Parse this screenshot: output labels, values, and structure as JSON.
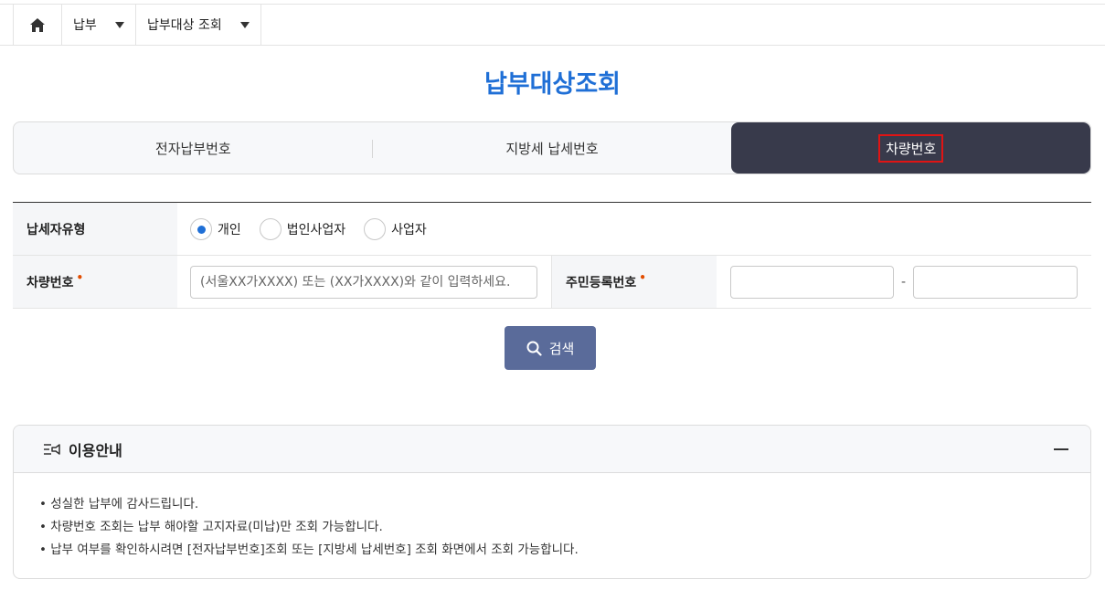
{
  "breadcrumb": {
    "home_icon": "home-icon",
    "items": [
      "납부",
      "납부대상 조회"
    ]
  },
  "page_title": "납부대상조회",
  "tabs": [
    {
      "label": "전자납부번호",
      "active": false
    },
    {
      "label": "지방세 납세번호",
      "active": false
    },
    {
      "label": "차량번호",
      "active": true
    }
  ],
  "form": {
    "taxpayer_type_label": "납세자유형",
    "taxpayer_types": [
      {
        "label": "개인",
        "selected": true
      },
      {
        "label": "법인사업자",
        "selected": false
      },
      {
        "label": "사업자",
        "selected": false
      }
    ],
    "car_number_label": "차량번호",
    "car_number_placeholder": "(서울XX가XXXX) 또는 (XX가XXXX)와 같이 입력하세요.",
    "resident_number_label": "주민등록번호",
    "resident_sep": "-",
    "required_mark": "•"
  },
  "search_button": "검색",
  "info": {
    "title": "이용안내",
    "items": [
      "성실한 납부에 감사드립니다.",
      "차량번호 조회는 납부 해야할 고지자료(미납)만 조회 가능합니다.",
      "납부 여부를 확인하시려면 [전자납부번호]조회 또는 [지방세 납세번호] 조회 화면에서 조회 가능합니다."
    ]
  },
  "colors": {
    "accent": "#1f6fd6",
    "active_tab": "#383a4b",
    "search_button": "#5a6b9a",
    "required": "#e24d00",
    "highlight_box": "#e01414"
  }
}
